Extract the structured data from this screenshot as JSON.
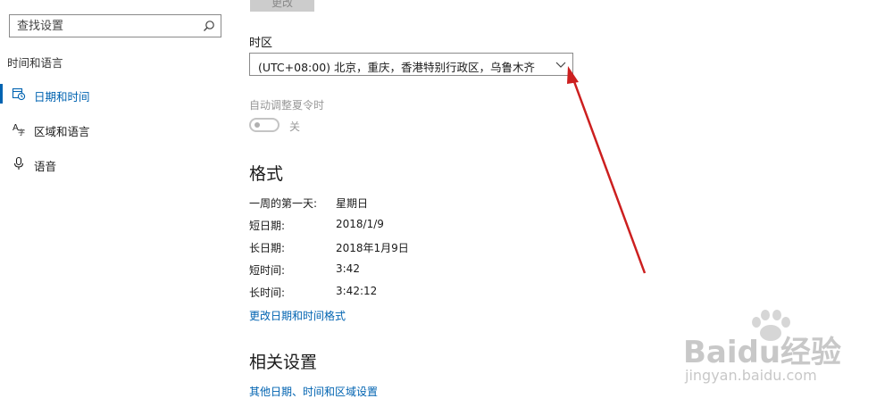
{
  "sidebar": {
    "search_placeholder": "查找设置",
    "section_title": "时间和语言",
    "items": [
      {
        "label": "日期和时间",
        "icon": "calendar-clock-icon",
        "active": true
      },
      {
        "label": "区域和语言",
        "icon": "language-icon",
        "active": false
      },
      {
        "label": "语音",
        "icon": "microphone-icon",
        "active": false
      }
    ]
  },
  "main": {
    "change_button_label": "更改",
    "timezone": {
      "label": "时区",
      "value": "(UTC+08:00) 北京，重庆，香港特别行政区，乌鲁木齐"
    },
    "dst": {
      "label": "自动调整夏令时",
      "state_label": "关",
      "on": false
    },
    "formats": {
      "title": "格式",
      "rows": [
        {
          "key": "一周的第一天:",
          "value": "星期日"
        },
        {
          "key": "短日期:",
          "value": "2018/1/9"
        },
        {
          "key": "长日期:",
          "value": "2018年1月9日"
        },
        {
          "key": "短时间:",
          "value": "3:42"
        },
        {
          "key": "长时间:",
          "value": "3:42:12"
        }
      ],
      "change_link": "更改日期和时间格式"
    },
    "related": {
      "title": "相关设置",
      "link": "其他日期、时间和区域设置"
    }
  },
  "annotation": {
    "arrow_color": "#cc1f1f"
  },
  "watermark": {
    "logo": "Baidu经验",
    "url": "jingyan.baidu.com"
  },
  "colors": {
    "accent": "#0063b1",
    "muted": "#999999"
  }
}
